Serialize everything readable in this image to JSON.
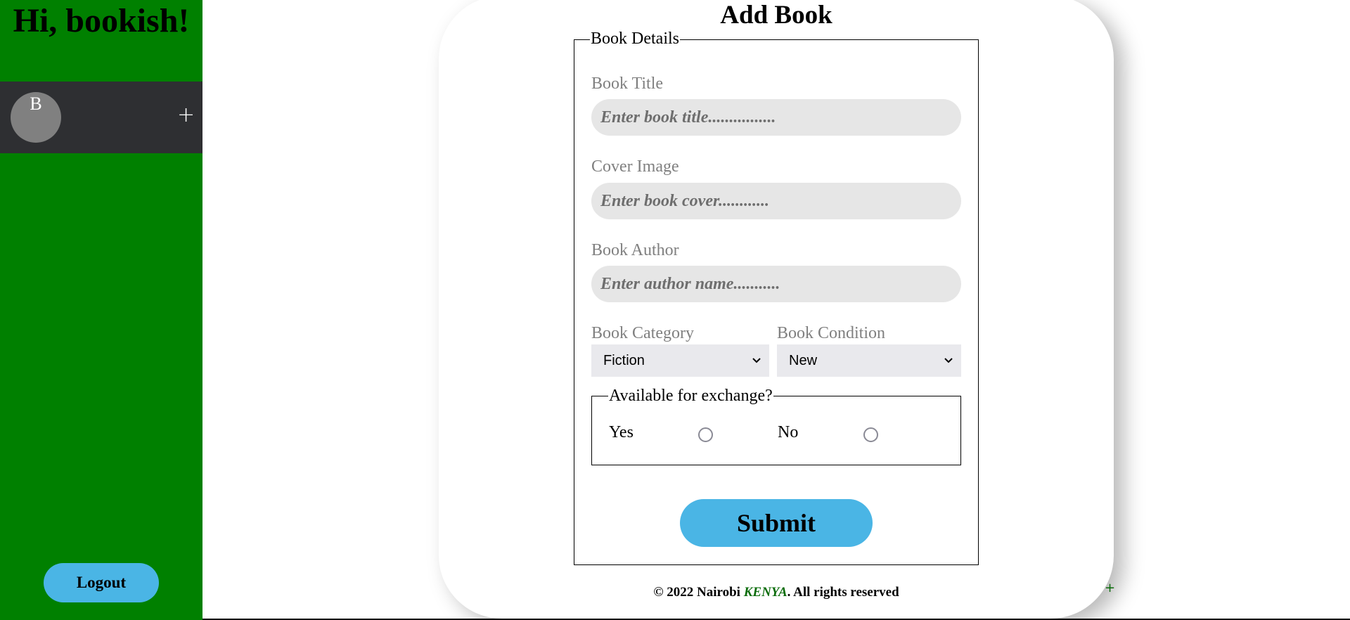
{
  "sidebar": {
    "greeting": "Hi, bookish!",
    "avatar_initial": "B",
    "add_button": "+",
    "logout_label": "Logout"
  },
  "form": {
    "title": "Add Book",
    "legend": "Book Details",
    "fields": {
      "title": {
        "label": "Book Title",
        "placeholder": "Enter book title................",
        "value": ""
      },
      "cover": {
        "label": "Cover Image",
        "placeholder": "Enter book cover............",
        "value": ""
      },
      "author": {
        "label": "Book Author",
        "placeholder": "Enter author name...........",
        "value": ""
      }
    },
    "category": {
      "label": "Book Category",
      "selected": "Fiction"
    },
    "condition": {
      "label": "Book Condition",
      "selected": "New"
    },
    "exchange": {
      "legend": "Available for exchange?",
      "options": [
        "Yes",
        "No"
      ],
      "selected": null
    },
    "submit_label": "Submit"
  },
  "footer": {
    "prefix": "© 2022 Nairobi ",
    "country": "KENYA",
    "suffix": ". All rights reserved",
    "corner": "+"
  },
  "colors": {
    "sidebar_bg": "#008000",
    "user_bar_bg": "#2e2f32",
    "button_accent": "#4ab5e5",
    "input_bg": "#e6e6e6",
    "footer_country": "#0a6b0a"
  }
}
